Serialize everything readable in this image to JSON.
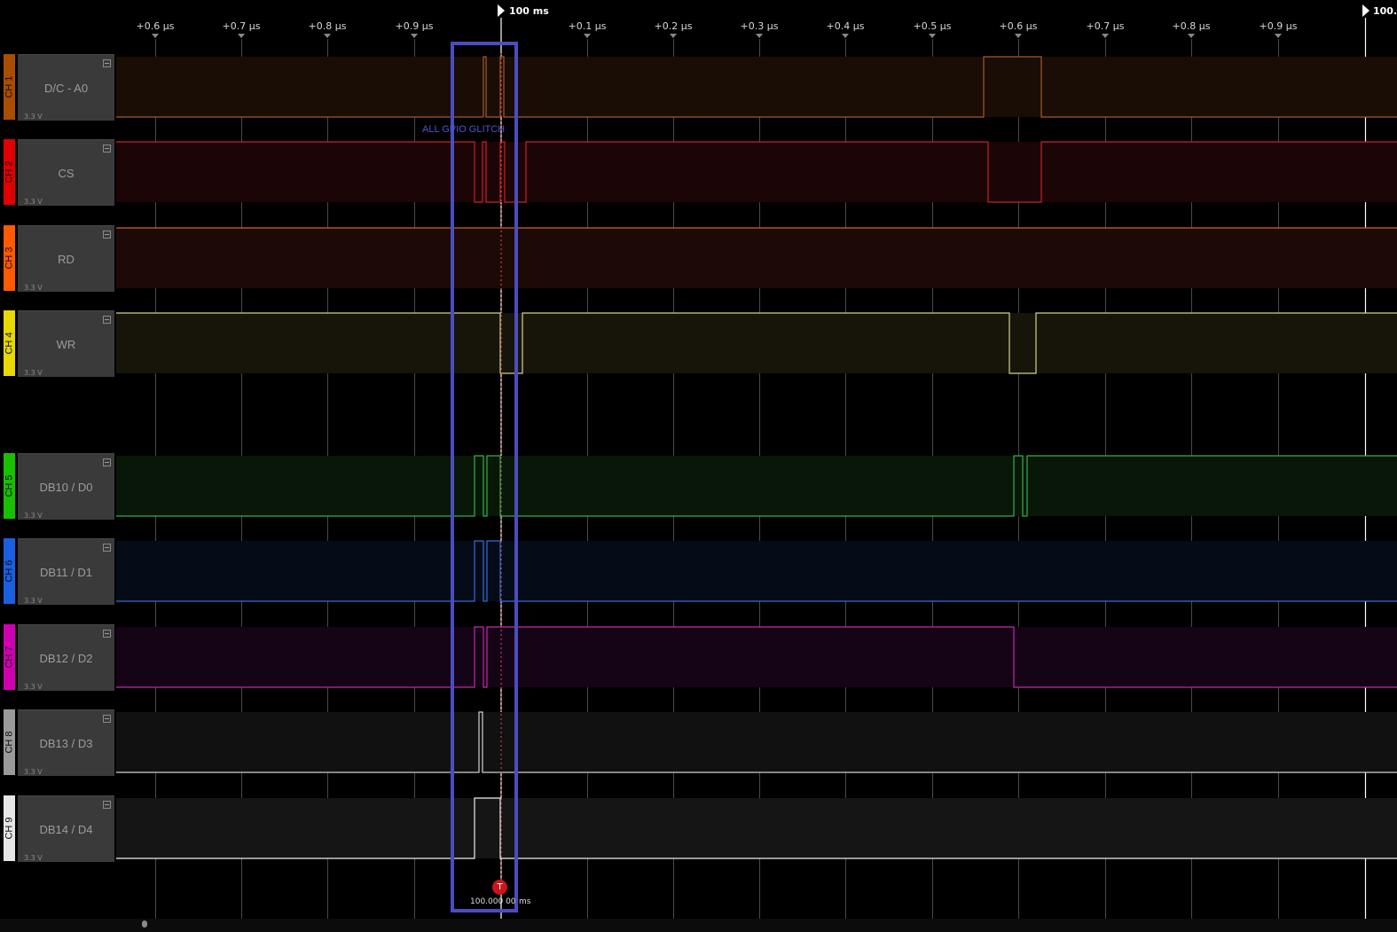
{
  "ruler": {
    "ticks": [
      "+0.6 µs",
      "+0.7 µs",
      "+0.8 µs",
      "+0.9 µs",
      "+0.1 µs",
      "+0.2 µs",
      "+0.3 µs",
      "+0.4 µs",
      "+0.5 µs",
      "+0.6 µs",
      "+0.7 µs",
      "+0.8 µs",
      "+0.9 µs"
    ],
    "marker_main": "100 ms",
    "marker_end": "100."
  },
  "channels": [
    {
      "tab": "CH 1",
      "name": "D/C - A0",
      "voltage": "3.3 V",
      "color": "#a94d00"
    },
    {
      "tab": "CH 2",
      "name": "CS",
      "voltage": "3.3 V",
      "color": "#e10000"
    },
    {
      "tab": "CH 3",
      "name": "RD",
      "voltage": "3.3 V",
      "color": "#ff5a00"
    },
    {
      "tab": "CH 4",
      "name": "WR",
      "voltage": "3.3 V",
      "color": "#e6d800"
    },
    {
      "tab": "CH 5",
      "name": "DB10 / D0",
      "voltage": "3.3 V",
      "color": "#18c000"
    },
    {
      "tab": "CH 6",
      "name": "DB11 / D1",
      "voltage": "3.3 V",
      "color": "#1a5fe0"
    },
    {
      "tab": "CH 7",
      "name": "DB12 / D2",
      "voltage": "3.3 V",
      "color": "#d000b0"
    },
    {
      "tab": "CH 8",
      "name": "DB13 / D3",
      "voltage": "3.3 V",
      "color": "#9a9a9a"
    },
    {
      "tab": "CH 9",
      "name": "DB14 / D4",
      "voltage": "3.3 V",
      "color": "#e6e6e6"
    }
  ],
  "annotation": "ALL GPIO GLITCH",
  "trigger": {
    "icon": "T",
    "time": "100.000 00",
    "unit": "ms"
  }
}
